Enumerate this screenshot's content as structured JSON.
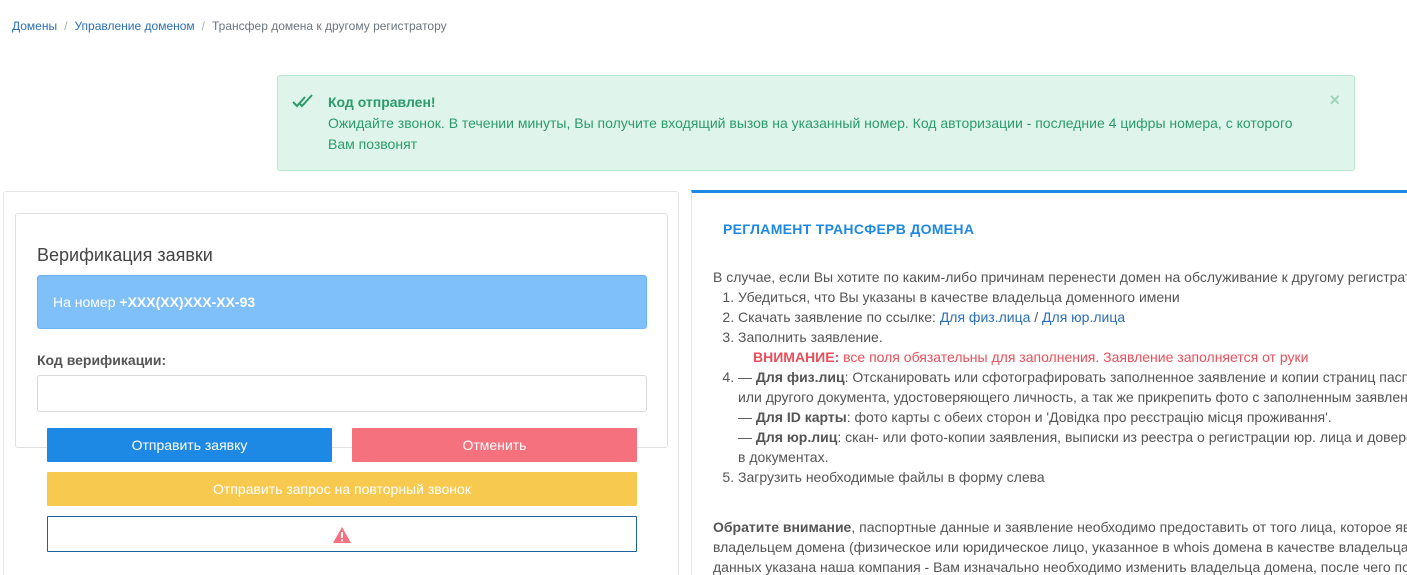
{
  "breadcrumb": {
    "items": [
      "Домены",
      "Управление доменом"
    ],
    "separator": "/",
    "current": "Трансфер домена к другому регистратору"
  },
  "alert": {
    "icon": "double-check-icon",
    "title": "Код отправлен!",
    "message": "Ожидайте звонок. В течении минуты, Вы получите входящий вызов на указанный номер. Код авторизации - последние 4 цифры номера, с которого Вам позвонят",
    "close": "×"
  },
  "verify": {
    "title": "Верификация заявки",
    "phone_prefix": "На номер ",
    "phone": "+XXX(XX)XXX-XX-93",
    "code_label": "Код верификации:",
    "code_value": ""
  },
  "buttons": {
    "send": "Отправить заявку",
    "cancel": "Отменить",
    "recall": "Отправить запрос на повторный звонок",
    "warn_icon": "warning-icon"
  },
  "rules": {
    "title": "РЕГЛАМЕНТ ТРАНСФЕРВ ДОМЕНА",
    "intro": "В случае, если Вы хотите по каким-либо причинам перенести домен на обслуживание к другому регистратору",
    "step1": "Убедиться, что Вы указаны в качестве владельца доменного имени",
    "step2_text": "Скачать заявление по ссылке: ",
    "link_phys": "Для физ.лица",
    "link_sep": " / ",
    "link_jur": "Для юр.лица",
    "step3": "Заполнить заявление.",
    "attention_label": "ВНИМАНИЕ:",
    "attention_text": " все поля обязательны для заполнения. Заявление заполняется от руки",
    "step4_dash": "— ",
    "step4_label": "Для физ.лиц",
    "step4_text": ": Отсканировать или сфотографировать заполненное заявление и копии страниц паспорта",
    "step4_cont": "или другого документа, удостоверяющего личность, а так же прикрепить фото с заполненным заявлением",
    "step4_id_label": "Для ID карты",
    "step4_id_text": ": фото карты с обеих сторон и 'Довідка про реєстрацію місця проживання'.",
    "step4_jur_label": "Для юр.лиц",
    "step4_jur_text": ": скан- или фото-копии заявления, выписки из реестра о регистрации юр. лица и доверенности",
    "step4_jur_cont": "в документах.",
    "step5": "Загрузить необходимые файлы в форму слева",
    "note_label": "Обратите внимание",
    "note_text": ", паспортные данные и заявление необходимо предоставить от того лица, которое является",
    "note_line2": "владельцем домена (физическое или юридическое лицо, указанное в whois домена в качестве владельца",
    "note_line3": "данных указана наша компания - Вам изначально необходимо изменить владельца домена, после чего подать"
  }
}
